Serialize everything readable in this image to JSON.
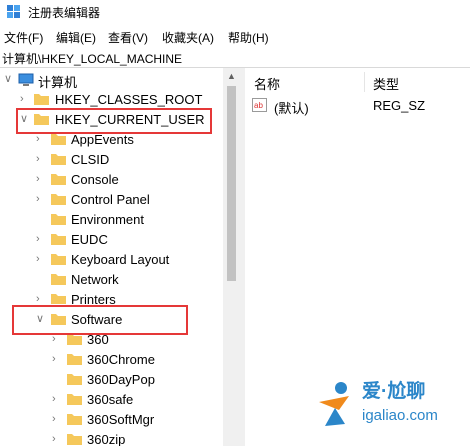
{
  "window": {
    "title": "注册表编辑器"
  },
  "menu": [
    "文件(F)",
    "编辑(E)",
    "查看(V)",
    "收藏夹(A)",
    "帮助(H)"
  ],
  "address": "计算机\\HKEY_LOCAL_MACHINE",
  "tree": {
    "root": "计算机",
    "hkcr": "HKEY_CLASSES_ROOT",
    "hkcu": "HKEY_CURRENT_USER",
    "hkcu_children": [
      "AppEvents",
      "CLSID",
      "Console",
      "Control Panel",
      "Environment",
      "EUDC",
      "Keyboard Layout",
      "Network",
      "Printers",
      "Software"
    ],
    "software_children": [
      "360",
      "360Chrome",
      "360DayPop",
      "360safe",
      "360SoftMgr",
      "360zip"
    ]
  },
  "list": {
    "col_name": "名称",
    "col_type": "类型",
    "rows": [
      {
        "name": "(默认)",
        "type": "REG_SZ",
        "icon": "ab-string-icon"
      }
    ]
  },
  "watermark": {
    "title": "爱·尬聊",
    "url": "igaliao.com"
  },
  "colors": {
    "highlight": "#e53838",
    "folder": "#f5c85b",
    "watermark": "#2b86c9",
    "accent": "#f08a1c"
  }
}
